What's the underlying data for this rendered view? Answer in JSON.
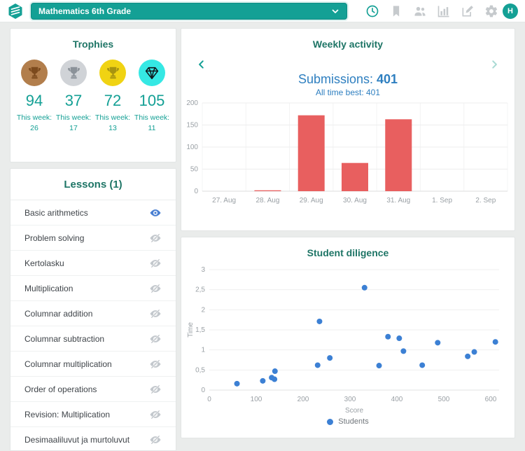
{
  "header": {
    "class_select_value": "Mathematics 6th Grade",
    "avatar_initial": "H",
    "icons": [
      "clock",
      "bookmark",
      "users",
      "bar-chart",
      "edit",
      "gear"
    ]
  },
  "colors": {
    "teal": "#14a095",
    "title_teal": "#1e7566",
    "blue_text": "#2e7fc0",
    "bar_red": "#e85f5f",
    "dot_blue": "#3c80d4",
    "axis_gray": "#9aa0a5",
    "icon_gray": "#c6cacd"
  },
  "trophies": {
    "title": "Trophies",
    "week_label": "This week:",
    "items": [
      {
        "type": "bronze-trophy",
        "count": "94",
        "week_count": "26",
        "circle_color": "#b27e4c",
        "icon_color": "#7c4a1d"
      },
      {
        "type": "silver-trophy",
        "count": "37",
        "week_count": "17",
        "circle_color": "#d0d3d7",
        "icon_color": "#8b9299"
      },
      {
        "type": "gold-trophy",
        "count": "72",
        "week_count": "13",
        "circle_color": "#f0d313",
        "icon_color": "#a89410"
      },
      {
        "type": "diamond-trophy",
        "count": "105",
        "week_count": "11",
        "circle_color": "#35e8e4",
        "icon_color": "#10171c"
      }
    ]
  },
  "lessons": {
    "title": "Lessons (1)",
    "items": [
      {
        "name": "Basic arithmetics",
        "visible": true
      },
      {
        "name": "Problem solving",
        "visible": false
      },
      {
        "name": "Kertolasku",
        "visible": false
      },
      {
        "name": "Multiplication",
        "visible": false
      },
      {
        "name": "Columnar addition",
        "visible": false
      },
      {
        "name": "Columnar subtraction",
        "visible": false
      },
      {
        "name": "Columnar multiplication",
        "visible": false
      },
      {
        "name": "Order of operations",
        "visible": false
      },
      {
        "name": "Revision: Multiplication",
        "visible": false
      },
      {
        "name": "Desimaaliluvut ja murtoluvut",
        "visible": false
      }
    ]
  },
  "weekly_activity": {
    "title": "Weekly activity",
    "submissions_label": "Submissions:",
    "submissions_value": "401",
    "best_text": "All time best: 401"
  },
  "diligence": {
    "title": "Student diligence"
  },
  "chart_data": [
    {
      "type": "bar",
      "title": "Weekly activity",
      "categories": [
        "27. Aug",
        "28. Aug",
        "29. Aug",
        "30. Aug",
        "31. Aug",
        "1. Sep",
        "2. Sep"
      ],
      "values": [
        0,
        2,
        172,
        64,
        163,
        0,
        0
      ],
      "xlabel": "",
      "ylabel": "",
      "ylim": [
        0,
        200
      ],
      "yticks": [
        0,
        50,
        100,
        150,
        200
      ],
      "bar_color": "#e85f5f",
      "grid": true,
      "legend_position": "none"
    },
    {
      "type": "scatter",
      "title": "Student diligence",
      "xlabel": "Score",
      "ylabel": "Time",
      "xlim": [
        0,
        650
      ],
      "ylim": [
        0,
        3
      ],
      "xticks": [
        0,
        100,
        200,
        300,
        400,
        500,
        600
      ],
      "yticks": [
        0,
        0.5,
        1,
        1.5,
        2,
        2.5,
        3
      ],
      "ytick_labels": [
        "0",
        "0,5",
        "1",
        "1,5",
        "2",
        "2,5",
        "3"
      ],
      "grid": true,
      "legend_position": "bottom-center",
      "legend": [
        {
          "label": "Students",
          "color": "#3c80d4"
        }
      ],
      "point_color": "#3c80d4",
      "points": [
        [
          59,
          0.16
        ],
        [
          114,
          0.23
        ],
        [
          133,
          0.31
        ],
        [
          139,
          0.27
        ],
        [
          140,
          0.47
        ],
        [
          231,
          0.62
        ],
        [
          235,
          1.71
        ],
        [
          257,
          0.8
        ],
        [
          331,
          2.55
        ],
        [
          362,
          0.61
        ],
        [
          381,
          1.33
        ],
        [
          405,
          1.29
        ],
        [
          414,
          0.97
        ],
        [
          454,
          0.62
        ],
        [
          487,
          1.18
        ],
        [
          551,
          0.84
        ],
        [
          565,
          0.95
        ],
        [
          610,
          1.2
        ]
      ]
    }
  ]
}
